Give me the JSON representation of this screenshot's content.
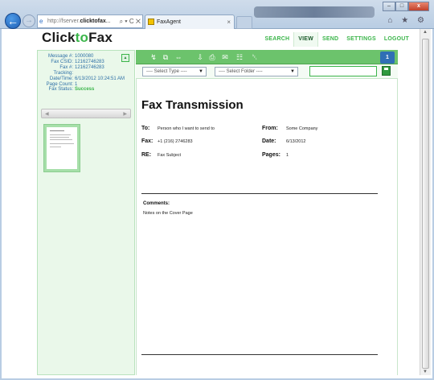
{
  "browser": {
    "address_url_prefix": "http://",
    "address_url_host": "fserver.",
    "address_url_domain": "clicktofax",
    "address_url_suffix": "...",
    "address_controls": "⌕ ▾ C ✕",
    "tab_title": "FaxAgent",
    "tab_close": "×",
    "chrome_icons": "⌂ ★ ⚙",
    "win_min": "–",
    "win_max": "□",
    "win_close": "x"
  },
  "app": {
    "logo_part1": "Click",
    "logo_part2": "to",
    "logo_part3": "Fax",
    "nav": [
      "SEARCH",
      "VIEW",
      "SEND",
      "SETTINGS",
      "LOGOUT"
    ],
    "active_nav": "VIEW"
  },
  "message": {
    "fields": [
      {
        "key": "Message #:",
        "value": "1000080"
      },
      {
        "key": "Fax CSID:",
        "value": "12162746283"
      },
      {
        "key": "Fax #:",
        "value": "12162746283"
      },
      {
        "key": "Tracking:",
        "value": ""
      },
      {
        "key": "Date/Time:",
        "value": "6/13/2012 10:24:51 AM"
      },
      {
        "key": "Page Count:",
        "value": "1"
      },
      {
        "key": "Fax Status:",
        "value": "Success"
      }
    ],
    "pager_prev": "◀",
    "pager_next": "▶"
  },
  "toolbar": {
    "icons": [
      "forward-icon",
      "copy-icon",
      "move-icon",
      "download-icon",
      "print-icon",
      "email-icon",
      "address-book-icon",
      "delete-icon"
    ],
    "glyphs": [
      "↯",
      "⧉",
      "⇔",
      "⇩",
      "⎙",
      "✉",
      "☷",
      "␡"
    ],
    "page_number": "1"
  },
  "filters": {
    "type_select": "---- Select Type ----",
    "folder_select": "---- Select Folder ----",
    "caret": "▼",
    "search_value": ""
  },
  "colors": {
    "brand_green": "#3bb54a",
    "toolbar_green": "#6cc36c",
    "sidebar_bg": "#eaf8ea",
    "link_blue": "#2d6fa6"
  },
  "fax": {
    "title": "Fax Transmission",
    "to_label": "To:",
    "to_value": "Person who I want to send to",
    "from_label": "From:",
    "from_value": "Some Company",
    "fax_label": "Fax:",
    "fax_value": "+1 (216) 2746283",
    "date_label": "Date:",
    "date_value": "6/13/2012",
    "re_label": "RE:",
    "re_value": "Fax Subject",
    "pages_label": "Pages:",
    "pages_value": "1",
    "comments_label": "Comments:",
    "comments_text": "Notes on the Cover Page"
  }
}
